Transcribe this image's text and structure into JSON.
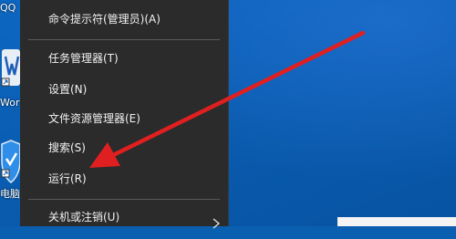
{
  "desktop": {
    "icons": [
      {
        "label": "QQ",
        "icon": "qq-icon"
      },
      {
        "label": "Wor",
        "icon": "word-icon"
      },
      {
        "label": "电脑",
        "icon": "pc-manager-icon"
      }
    ]
  },
  "menu": {
    "items": [
      {
        "label": "命令提示符(管理员)(A)"
      },
      {
        "label": "任务管理器(T)"
      },
      {
        "label": "设置(N)"
      },
      {
        "label": "文件资源管理器(E)"
      },
      {
        "label": "搜索(S)"
      },
      {
        "label": "运行(R)"
      },
      {
        "label": "关机或注销(U)",
        "has_submenu": true
      }
    ]
  },
  "annotation": {
    "type": "red-arrow",
    "points_to": "运行(R)",
    "color": "#e02020"
  },
  "colors": {
    "menu_bg": "#2b2b2b",
    "menu_text": "#f2f2f2",
    "desktop_blue": "#0a5fb0"
  }
}
